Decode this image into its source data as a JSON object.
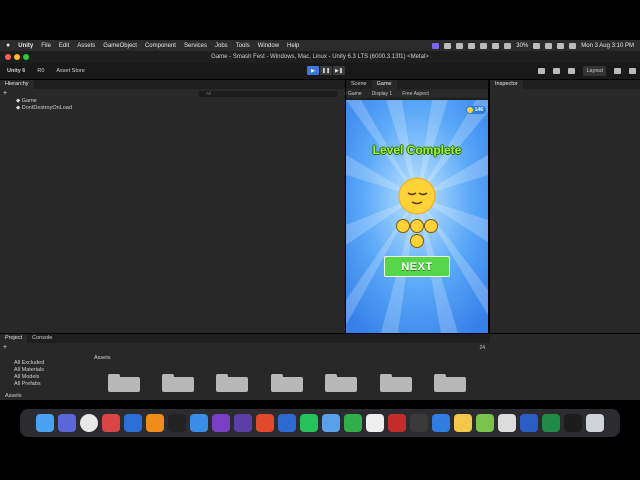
{
  "menubar": {
    "app": "Unity",
    "items": [
      "File",
      "Edit",
      "Assets",
      "GameObject",
      "Component",
      "Services",
      "Jobs",
      "Tools",
      "Window",
      "Help"
    ],
    "battery": "30%",
    "datetime": "Mon 3 Aug  3:10 PM"
  },
  "window": {
    "title": "Game - Smash Fest - Windows, Mac, Linux - Unity 6.3 LTS (6000.3.13f1) <Metal>"
  },
  "toolbar": {
    "account": "Unity 6",
    "view_mode": "R0",
    "asset_store": "Asset Store",
    "layout": "Layout"
  },
  "hierarchy": {
    "tab": "Hierarchy",
    "search_placeholder": "All",
    "items": [
      "Game",
      "DontDestroyOnLoad"
    ]
  },
  "center_tabs": {
    "scene": "Scene",
    "game": "Game"
  },
  "game_toolbar": {
    "mode": "Game",
    "display": "Display 1",
    "aspect": "Free Aspect"
  },
  "inspector": {
    "tab": "Inspector"
  },
  "game": {
    "coin_count": "146",
    "headline": "Level Complete",
    "next_button": "NEXT",
    "colors": {
      "sky": "#3d8ff2",
      "headline": "#9cf23c",
      "button": "#56d44a",
      "face": "#ffd238"
    }
  },
  "bottom_tabs": {
    "project": "Project",
    "console": "Console"
  },
  "project": {
    "search_filters": [
      "All Excluded",
      "All Materials",
      "All Models",
      "All Prefabs"
    ],
    "assets_label": "Assets",
    "assets_tree_label": "Assets",
    "count": "24"
  },
  "dock": {
    "apps": [
      "finder-icon",
      "launchpad-icon",
      "chrome-icon",
      "app-icon",
      "word-icon",
      "blender-icon",
      "terminal-icon",
      "safari-icon",
      "visual-studio-icon",
      "visual-studio-code-icon",
      "app-icon",
      "mp3-icon",
      "whatsapp-icon",
      "app-icon",
      "app-icon",
      "app-icon",
      "app-icon",
      "app-icon",
      "app-icon",
      "app-icon",
      "app-icon",
      "app-icon",
      "word-icon",
      "excel-icon",
      "unity-icon",
      "trash-icon"
    ]
  }
}
